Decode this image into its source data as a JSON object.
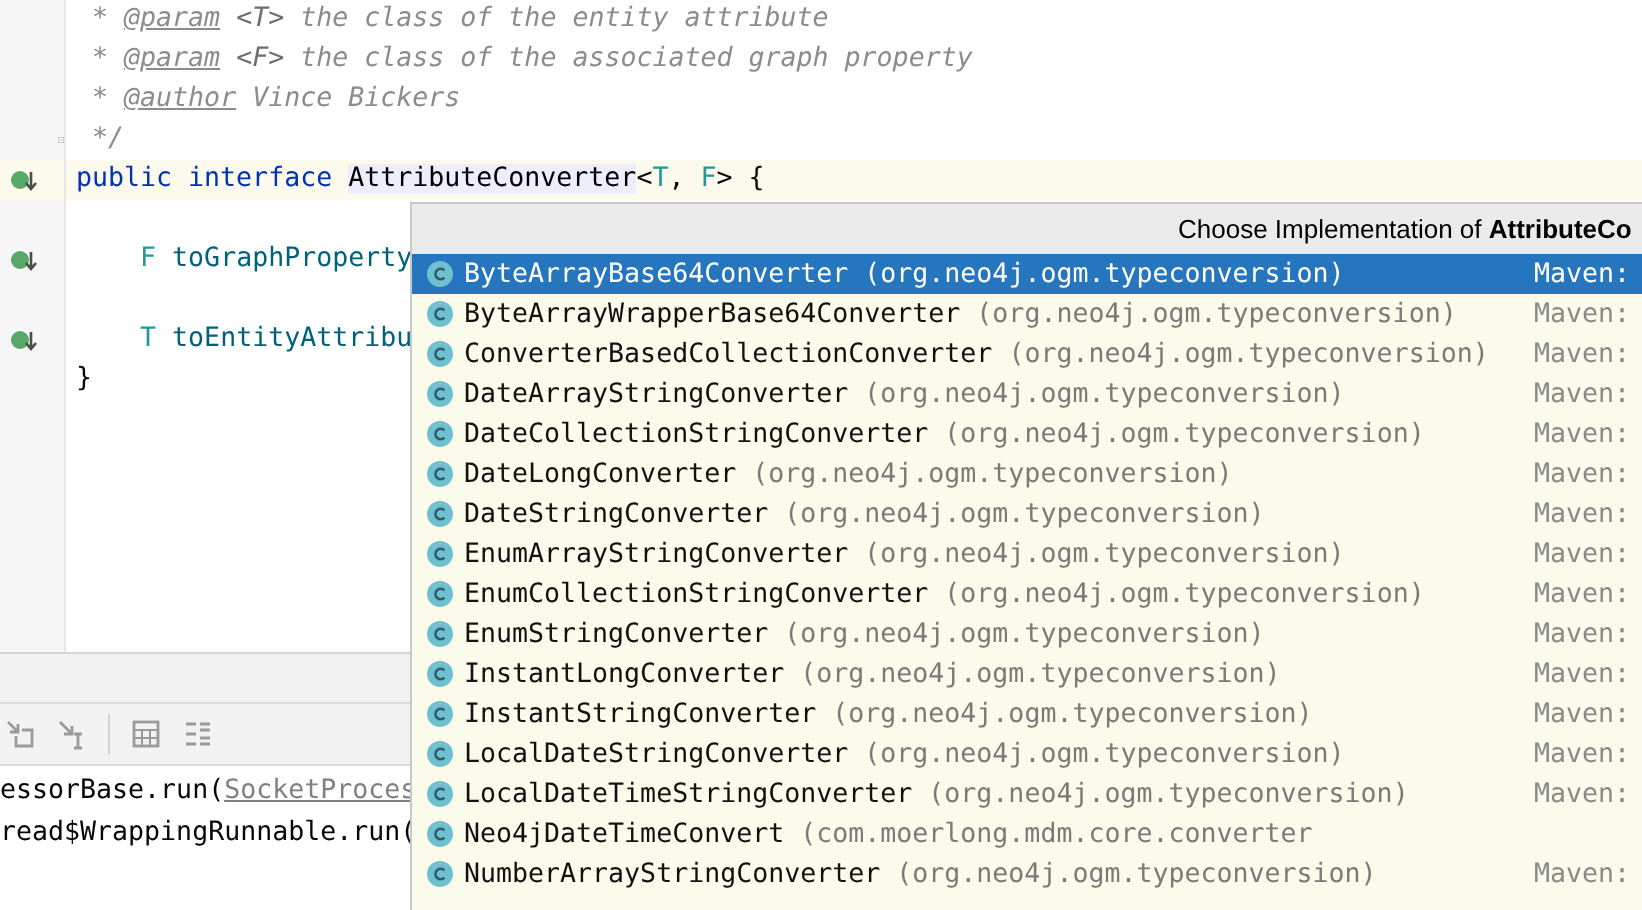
{
  "editor": {
    "lines": [
      {
        "kind": "comment",
        "segments": [
          {
            "t": " * ",
            "kind": "comment"
          },
          {
            "t": "@param",
            "kind": "tag"
          },
          {
            "t": " <T> ",
            "kind": "commentref"
          },
          {
            "t": "the class of the entity attribute",
            "kind": "comment"
          }
        ]
      },
      {
        "kind": "comment",
        "segments": [
          {
            "t": " * ",
            "kind": "comment"
          },
          {
            "t": "@param",
            "kind": "tag"
          },
          {
            "t": " <F> ",
            "kind": "commentref"
          },
          {
            "t": "the class of the associated graph property",
            "kind": "comment"
          }
        ]
      },
      {
        "kind": "comment",
        "segments": [
          {
            "t": " * ",
            "kind": "comment"
          },
          {
            "t": "@author",
            "kind": "tag"
          },
          {
            "t": " Vince Bickers",
            "kind": "comment"
          }
        ]
      },
      {
        "kind": "comment",
        "gutter_icon": {
          "kind": "fold"
        },
        "segments": [
          {
            "t": " */",
            "kind": "comment"
          }
        ]
      },
      {
        "kind": "code",
        "gutter_icon": {
          "kind": "implement"
        },
        "current": true,
        "segments": [
          {
            "t": "public interface ",
            "kind": "keyword"
          },
          {
            "t": "AttributeConverter",
            "kind": "highlight"
          },
          {
            "t": "<",
            "kind": "plain"
          },
          {
            "t": "T",
            "kind": "typeparam"
          },
          {
            "t": ", ",
            "kind": "plain"
          },
          {
            "t": "F",
            "kind": "typeparam"
          },
          {
            "t": "> {",
            "kind": "plain"
          }
        ]
      },
      {
        "kind": "blank"
      },
      {
        "kind": "code",
        "gutter_icon": {
          "kind": "implement"
        },
        "segments": [
          {
            "t": "    F ",
            "kind": "typeparam"
          },
          {
            "t": "toGraphProperty",
            "kind": "method"
          }
        ]
      },
      {
        "kind": "blank"
      },
      {
        "kind": "code",
        "gutter_icon": {
          "kind": "implement"
        },
        "segments": [
          {
            "t": "    T ",
            "kind": "typeparam"
          },
          {
            "t": "toEntityAttribu",
            "kind": "method"
          }
        ]
      },
      {
        "kind": "code",
        "segments": [
          {
            "t": "}",
            "kind": "plain"
          }
        ]
      }
    ]
  },
  "console": {
    "lines": [
      {
        "segments": [
          {
            "t": "essorBase.run(",
            "kind": "plain"
          },
          {
            "t": "SocketProces",
            "kind": "link"
          }
        ]
      },
      {
        "segments": [
          {
            "t": "read$WrappingRunnable.run(",
            "kind": "plain"
          }
        ]
      }
    ]
  },
  "popup": {
    "title": "Choose Implementation of **AttributeCo**",
    "items": [
      {
        "name": "ByteArrayBase64Converter",
        "package": "(org.neo4j.ogm.typeconversion)",
        "source": "Maven:",
        "selected": true
      },
      {
        "name": "ByteArrayWrapperBase64Converter",
        "package": "(org.neo4j.ogm.typeconversion)",
        "source": "Maven:",
        "selected": false
      },
      {
        "name": "ConverterBasedCollectionConverter",
        "package": "(org.neo4j.ogm.typeconversion)",
        "source": "Maven:",
        "selected": false
      },
      {
        "name": "DateArrayStringConverter",
        "package": "(org.neo4j.ogm.typeconversion)",
        "source": "Maven:",
        "selected": false
      },
      {
        "name": "DateCollectionStringConverter",
        "package": "(org.neo4j.ogm.typeconversion)",
        "source": "Maven:",
        "selected": false
      },
      {
        "name": "DateLongConverter",
        "package": "(org.neo4j.ogm.typeconversion)",
        "source": "Maven:",
        "selected": false
      },
      {
        "name": "DateStringConverter",
        "package": "(org.neo4j.ogm.typeconversion)",
        "source": "Maven:",
        "selected": false
      },
      {
        "name": "EnumArrayStringConverter",
        "package": "(org.neo4j.ogm.typeconversion)",
        "source": "Maven:",
        "selected": false
      },
      {
        "name": "EnumCollectionStringConverter",
        "package": "(org.neo4j.ogm.typeconversion)",
        "source": "Maven:",
        "selected": false
      },
      {
        "name": "EnumStringConverter",
        "package": "(org.neo4j.ogm.typeconversion)",
        "source": "Maven:",
        "selected": false
      },
      {
        "name": "InstantLongConverter",
        "package": "(org.neo4j.ogm.typeconversion)",
        "source": "Maven:",
        "selected": false
      },
      {
        "name": "InstantStringConverter",
        "package": "(org.neo4j.ogm.typeconversion)",
        "source": "Maven:",
        "selected": false
      },
      {
        "name": "LocalDateStringConverter",
        "package": "(org.neo4j.ogm.typeconversion)",
        "source": "Maven:",
        "selected": false
      },
      {
        "name": "LocalDateTimeStringConverter",
        "package": "(org.neo4j.ogm.typeconversion)",
        "source": "Maven:",
        "selected": false
      },
      {
        "name": "Neo4jDateTimeConvert",
        "package": "(com.moerlong.mdm.core.converter",
        "selected": false
      },
      {
        "name": "NumberArrayStringConverter",
        "package": "(org.neo4j.ogm.typeconversion)",
        "source": "Maven:",
        "selected": false
      }
    ]
  }
}
